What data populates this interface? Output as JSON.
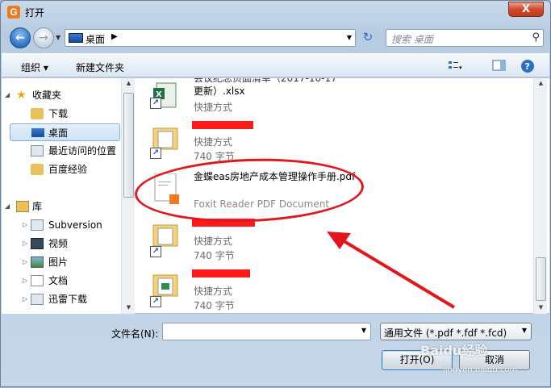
{
  "window": {
    "title": "打开",
    "close_label": "X",
    "app_icon": "G"
  },
  "address": {
    "location": "桌面",
    "search_placeholder": "搜索 桌面"
  },
  "toolbar": {
    "organize": "组织 ▾",
    "new_folder": "新建文件夹"
  },
  "sidebar": {
    "favorites_header": "收藏夹",
    "favorites": [
      {
        "label": "下载",
        "icon": "download-folder-icon"
      },
      {
        "label": "桌面",
        "icon": "desktop-icon",
        "selected": true
      },
      {
        "label": "最近访问的位置",
        "icon": "recent-places-icon"
      },
      {
        "label": "百度经验",
        "icon": "folder-icon"
      }
    ],
    "libraries_header": "库",
    "libraries": [
      {
        "label": "Subversion",
        "icon": "library-icon"
      },
      {
        "label": "视频",
        "icon": "video-library-icon"
      },
      {
        "label": "图片",
        "icon": "pictures-library-icon"
      },
      {
        "label": "文档",
        "icon": "documents-library-icon"
      },
      {
        "label": "迅雷下载",
        "icon": "thunder-download-icon"
      }
    ]
  },
  "files": [
    {
      "name": "更新）.xlsx",
      "name_top": "会议纪念页面清单（2017-10-17",
      "type": "快捷方式",
      "icon": "excel-shortcut-icon"
    },
    {
      "name": "",
      "type": "快捷方式",
      "size": "740 字节",
      "icon": "folder-shortcut-icon",
      "redacted": true
    },
    {
      "name": "金蝶eas房地产成本管理操作手册.pdf",
      "type": "Foxit Reader PDF Document",
      "icon": "pdf-icon",
      "highlighted": true
    },
    {
      "name": "",
      "type": "快捷方式",
      "size": "740 字节",
      "icon": "folder-shortcut-icon",
      "redacted": true
    },
    {
      "name": "",
      "type": "快捷方式",
      "size": "740 字节",
      "icon": "folder-shortcut-icon",
      "redacted": true
    }
  ],
  "bottom": {
    "filename_label": "文件名(N):",
    "filename_value": "",
    "filter": "通用文件 (*.pdf *.fdf *.fcd)",
    "open_button": "打开(O)",
    "cancel_button": "取消"
  },
  "watermark": {
    "text": "Baidu经验",
    "url": "jingyan.baidu.com"
  },
  "colors": {
    "annotation": "#e2161c",
    "accent": "#2a6fc4"
  }
}
